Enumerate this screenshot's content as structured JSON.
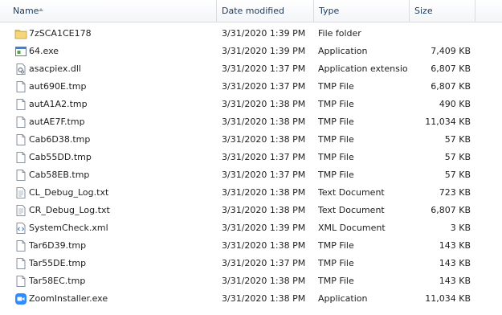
{
  "columns": {
    "name": "Name",
    "date": "Date modified",
    "type": "Type",
    "size": "Size"
  },
  "files": [
    {
      "name": "7zSCA1CE178",
      "date": "3/31/2020 1:39 PM",
      "type": "File folder",
      "size": "",
      "icon": "folder-icon"
    },
    {
      "name": "64.exe",
      "date": "3/31/2020 1:39 PM",
      "type": "Application",
      "size": "7,409 KB",
      "icon": "application-icon"
    },
    {
      "name": "asacpiex.dll",
      "date": "3/31/2020 1:37 PM",
      "type": "Application extension",
      "size": "6,807 KB",
      "icon": "dll-icon"
    },
    {
      "name": "aut690E.tmp",
      "date": "3/31/2020 1:37 PM",
      "type": "TMP File",
      "size": "6,807 KB",
      "icon": "blank-file-icon"
    },
    {
      "name": "autA1A2.tmp",
      "date": "3/31/2020 1:38 PM",
      "type": "TMP File",
      "size": "490 KB",
      "icon": "blank-file-icon"
    },
    {
      "name": "autAE7F.tmp",
      "date": "3/31/2020 1:38 PM",
      "type": "TMP File",
      "size": "11,034 KB",
      "icon": "blank-file-icon"
    },
    {
      "name": "Cab6D38.tmp",
      "date": "3/31/2020 1:38 PM",
      "type": "TMP File",
      "size": "57 KB",
      "icon": "blank-file-icon"
    },
    {
      "name": "Cab55DD.tmp",
      "date": "3/31/2020 1:37 PM",
      "type": "TMP File",
      "size": "57 KB",
      "icon": "blank-file-icon"
    },
    {
      "name": "Cab58EB.tmp",
      "date": "3/31/2020 1:37 PM",
      "type": "TMP File",
      "size": "57 KB",
      "icon": "blank-file-icon"
    },
    {
      "name": "CL_Debug_Log.txt",
      "date": "3/31/2020 1:38 PM",
      "type": "Text Document",
      "size": "723 KB",
      "icon": "text-file-icon"
    },
    {
      "name": "CR_Debug_Log.txt",
      "date": "3/31/2020 1:38 PM",
      "type": "Text Document",
      "size": "6,807 KB",
      "icon": "text-file-icon"
    },
    {
      "name": "SystemCheck.xml",
      "date": "3/31/2020 1:39 PM",
      "type": "XML Document",
      "size": "3 KB",
      "icon": "xml-file-icon"
    },
    {
      "name": "Tar6D39.tmp",
      "date": "3/31/2020 1:38 PM",
      "type": "TMP File",
      "size": "143 KB",
      "icon": "blank-file-icon"
    },
    {
      "name": "Tar55DE.tmp",
      "date": "3/31/2020 1:37 PM",
      "type": "TMP File",
      "size": "143 KB",
      "icon": "blank-file-icon"
    },
    {
      "name": "Tar58EC.tmp",
      "date": "3/31/2020 1:38 PM",
      "type": "TMP File",
      "size": "143 KB",
      "icon": "blank-file-icon"
    },
    {
      "name": "ZoomInstaller.exe",
      "date": "3/31/2020 1:38 PM",
      "type": "Application",
      "size": "11,034 KB",
      "icon": "zoom-icon"
    }
  ],
  "colors": {
    "header_text": "#1e395b",
    "folder": "#e8c25a",
    "zoom": "#2d8cff"
  }
}
